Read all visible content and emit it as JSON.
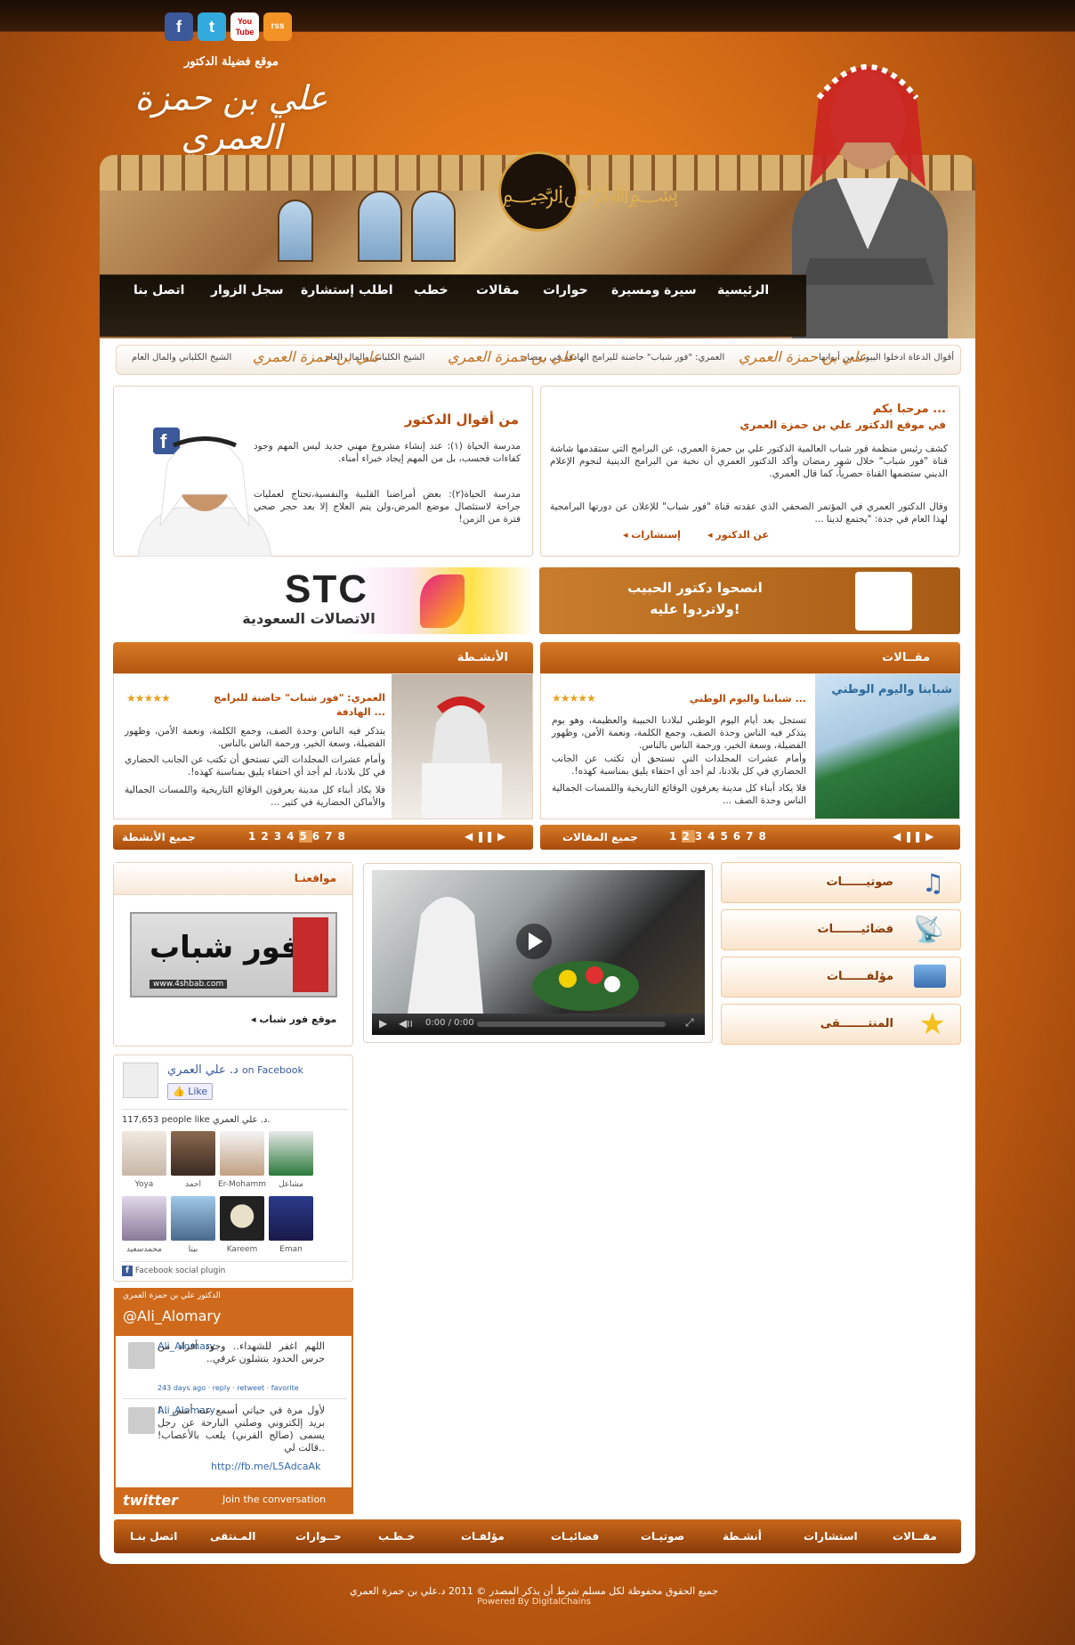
{
  "social": {
    "facebook": "f",
    "twitter": "t",
    "youtube": "You Tube",
    "rss": "rss"
  },
  "logo": {
    "subtitle": "موقع فضيلة الدكتور",
    "name": "علي بن حمزة العمري"
  },
  "nav": [
    "الرئيسية",
    "سيرة ومسيرة",
    "حوارات",
    "مقالات",
    "خطب",
    "اطلب إستشارة",
    "سجل الزوار",
    "اتصل بنا"
  ],
  "ticker": {
    "items": [
      "أقوال الدعاة ادخلوا البيوت من أبوابها",
      "العمري: \"فور شباب\" حاضنة للبرامج الهادفة في رمضان",
      "الشيخ الكلباني والمال العام",
      "الشيخ الكلباني والمال العام"
    ],
    "logo": "علي بن حمزة العمري"
  },
  "welcome": {
    "title": "مرحبا بكم ...",
    "subtitle": "في موقع الدكتور علي بن حمزة العمري",
    "p1": "كشف رئيس منظمة فور شباب العالمية الدكتور علي بن حمزة العمري، عن البرامج التي ستقدمها شاشة قناة \"فور شباب\" خلال شهر رمضان وأكد الدكتور العمري أن نخبة من البرامج الدينية لنجوم الإعلام الديني ستضمها القناة حصرياً، كما قال العمري.",
    "p2": "وقال الدكتور العمري في المؤتمر الصحفي الذي عقدته قناة \"فور شباب\" للإعلان عن دورتها البرامجية لهذا العام في جدة: \"يجتمع لدينا ...",
    "link1": "عن الدكتور",
    "link2": "إستشارات"
  },
  "quotes": {
    "title": "من أقوال الدكتور",
    "q1": "مدرسة الحياة (١): عند إنشاء مشروع مهني جديد ليس المهم وجود كفاءات فحسب، بل من المهم إيجاد خبراء أمناء.",
    "q2": "مدرسة الحياة(٢): بعض أمراضنا القلبية والنفسية،تحتاج لعمليات جراحة لاستئصال موضع المرض،ولن يتم العلاج إلا بعد حجر صحي فترة من الزمن!"
  },
  "ads": {
    "advice_line1": "انصحوا دكتور الحبيب",
    "advice_line2": "ولاتردوا عليه!",
    "stc_logo": "STC",
    "stc_ar": "الاتصالات السعودية"
  },
  "articles": {
    "header": "مقــالات",
    "image_caption": "شبابنا واليوم الوطني",
    "title": "شبابنا واليوم الوطني ...",
    "p1": "تستجل بعد أيام اليوم الوطني لبلادنا الحبيبة والعظيمة، وهو يوم يتذكر فيه الناس وحدة الصف، وجمع الكلمة، ونعمة الأمن، وظهور الفضيلة، وسعة الخير، ورحمة الناس بالناس.",
    "p2": "وأمام عشرات المجلدات التي تستحق أن تكتب عن الجانب الحضاري في كل بلادنا، لم أجد أي احتفاء يليق بمناسبة كهذه!.",
    "p3": "فلا يكاد أبناء كل مدينة يعرفون الوقائع التاريخية واللمسات الجمالية الناس وحدة الصف ...",
    "all": "جميع المقالات",
    "pages": [
      "1",
      "2",
      "3",
      "4",
      "5",
      "6",
      "7",
      "8"
    ],
    "active": "2"
  },
  "activities": {
    "header": "الأنشـطة",
    "title": "العمري: \"فور شباب\" حاضنة للبرامج الهادفة ...",
    "p1": "يتذكر فيه الناس وحدة الصف، وجمع الكلمة، ونعمة الأمن، وظهور الفضيلة، وسعة الخير، ورحمة الناس بالناس.",
    "p2": "وأمام عشرات المجلدات التي تستحق أن تكتب عن الجانب الحضاري في كل بلادنا، لم أجد أي احتفاء يليق بمناسبة كهذه!.",
    "p3": "فلا يكاد أبناء كل مدينة يعرفون الوقائع التاريخية واللمسات الجمالية والأماكن الحضارية في كثير ...",
    "all": "جميع الأنشطة",
    "pages": [
      "1",
      "2",
      "3",
      "4",
      "5",
      "6",
      "7",
      "8"
    ],
    "active": "5"
  },
  "media_tabs": [
    "صوتيــــــات",
    "فضائيـــــــات",
    "مؤلفــــــات",
    "المنتـــــــقى"
  ],
  "video": {
    "time": "0:00 / 0:00"
  },
  "sites": {
    "header": "مواقعنـا",
    "banner_text": "فور شباب",
    "banner_url": "www.4shbab.com",
    "link": "موقع فور شباب"
  },
  "facebook": {
    "page": "د. علي العمري",
    "on": "on Facebook",
    "like": "Like",
    "count": "117,653 people like",
    "fans": [
      "Yoya",
      "أحمد",
      "Er-Mohamm",
      "مشاعل",
      "محمدسعيد",
      "بيتا",
      "Kareem",
      "Eman"
    ],
    "plugin": "Facebook social plugin"
  },
  "twitter": {
    "header_small": "الدكتور علي بن حمزة العمري",
    "handle": "@Ali_Alomary",
    "t1_user": "Ali_Alomary",
    "t1_text": "اللهم اغفر للشهداء.. وجود أفراد من حرس الحدود يتشلون غرقي..",
    "t1_meta": "243 days ago · reply · retweet · favorite",
    "t2_user": "Ali_Alomary",
    "t2_text": "لأول مرة في حياتي أسمع عنه أمس ..! بريد إلكتروني وصلني البارحة عن رجل يسمى (صالح القرني) يلعب بالأعصاب! ..قالت لي",
    "t2_link": "http://fb.me/L5AdcaAk",
    "logo": "twitter",
    "join": "Join the conversation"
  },
  "footer_nav": [
    "مقــالات",
    "استشارات",
    "أنشـطة",
    "صوتيـات",
    "فضائيـات",
    "مؤلفـات",
    "حــوارات",
    "المـنتقى",
    "خـطـب",
    "اتصل بنـا"
  ],
  "copyright": "جميع الحقوق محفوظة لكل مسلم شرط أن يذكر المصدر © 2011 د.علي بن حمزة العمري",
  "powered": "Powered By DigitalChains",
  "colors": {
    "accent": "#c0600f",
    "dark": "#1a0d05",
    "link": "#b54a07"
  }
}
